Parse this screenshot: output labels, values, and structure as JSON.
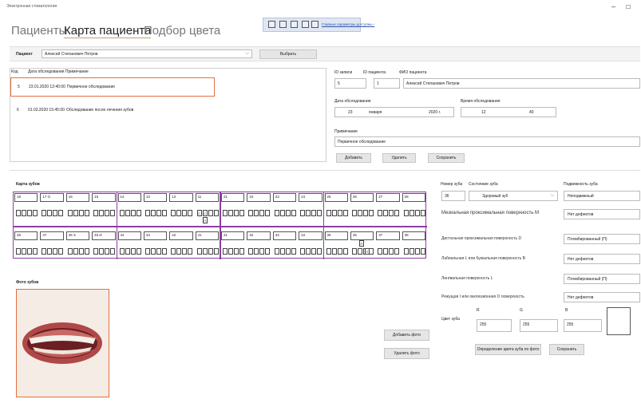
{
  "window": {
    "title": "Электронная стоматология",
    "minimize_icon": "–",
    "maximize_icon": "☐"
  },
  "tabs": [
    {
      "label": "Пациенты",
      "active": false
    },
    {
      "label": "Карта пациента",
      "active": true
    },
    {
      "label": "Подбор цвета",
      "active": false
    }
  ],
  "toolbar": {
    "link_label": "Главные параметры доступны ‹"
  },
  "patient": {
    "label": "Пациент",
    "value": "Алексей Степанович Петров",
    "select_button": "Выбрать"
  },
  "visits": {
    "headers": [
      "Код",
      "Дата обследования Примечание"
    ],
    "rows": [
      {
        "code": "5",
        "date": "23.01.2020 12:40:00",
        "note": "Первичное обследование",
        "selected": true
      },
      {
        "code": "6",
        "date": "01.02.2020 15:45:00",
        "note": "Обследование после лечения зубов",
        "selected": false
      }
    ]
  },
  "record": {
    "record_id_label": "ID записи",
    "record_id": "5",
    "patient_id_label": "ID пациента",
    "patient_id": "1",
    "fio_label": "ФИО пациента",
    "fio": "Алексей Степанович Петров",
    "date_label": "Дата обследования",
    "day": "23",
    "month": "января",
    "year": "2020 г.",
    "time_label": "Время обследования",
    "hour": "12",
    "minute": "40",
    "note_label": "Примечание",
    "note": "Первичное обследование",
    "add_button": "Добавить",
    "delete_button": "Удалить",
    "save_button": "Сохранить"
  },
  "teeth_map": {
    "title": "Карта зубов",
    "upper": [
      "18",
      "17 O",
      "16",
      "15",
      "14",
      "13",
      "12",
      "11",
      "21",
      "22",
      "23",
      "24",
      "25",
      "26",
      "27",
      "28"
    ],
    "lower": [
      "48",
      "47",
      "46 X",
      "45 И",
      "44",
      "43",
      "42",
      "41",
      "31",
      "32",
      "33",
      "34",
      "35",
      "36",
      "37",
      "38"
    ],
    "marks": {
      "c1": "С",
      "c2": "С",
      "p1": "П",
      "p2": "П",
      "p3": "П"
    }
  },
  "tooth": {
    "number_label": "Номер зуба",
    "number": "36",
    "state_label": "Состояние зуба",
    "state": "Здоровый зуб",
    "mobility_label": "Подвижность зуба",
    "mobility": "Неподвижный",
    "surfaces": [
      {
        "label": "Мезиальная проксимальная поверхность M",
        "value": "Нет дефектов"
      },
      {
        "label": "Дистальная проксимальная поверхность D",
        "value": "Пломбированный (П)"
      },
      {
        "label": "Лабиальная L или буккальная поверхность B",
        "value": "Нет дефектов"
      },
      {
        "label": "Лингвальная поверхность L",
        "value": "Пломбированный (П)"
      },
      {
        "label": "Режущая I или окклюзионная O поверхность",
        "value": "Нет дефектов"
      }
    ],
    "color_label": "Цвет зуба",
    "r_label": "R",
    "g_label": "G",
    "b_label": "B",
    "r": "255",
    "g": "255",
    "b": "255",
    "detect_button": "Определение цвета зуба по фото",
    "save_button": "Сохранить"
  },
  "photos": {
    "title": "Фото зубов",
    "add_button": "Добавить фото",
    "delete_button": "Удалить фото"
  }
}
